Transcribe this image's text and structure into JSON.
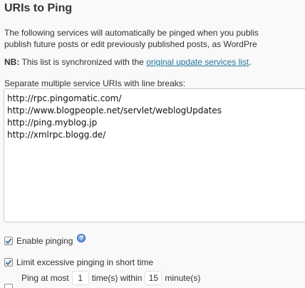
{
  "section_title": "URIs to Ping",
  "intro": {
    "line1": "The following services will automatically be pinged when you publis",
    "line2": "publish future posts or edit previously published posts, as WordPre"
  },
  "note": {
    "label": "NB:",
    "text": " This list is synchronized with the ",
    "link": "original update services list",
    "end": "."
  },
  "uris_label": "Separate multiple service URIs with line breaks:",
  "uris": [
    "http://rpc.pingomatic.com/",
    "http://www.blogpeople.net/servlet/weblogUpdates",
    "http://ping.myblog.jp",
    "http://xmlrpc.blogg.de/"
  ],
  "enable_pinging": {
    "label": "Enable pinging",
    "checked": true,
    "help_glyph": "?"
  },
  "limit_pinging": {
    "label": "Limit excessive pinging in short time",
    "checked": true
  },
  "ping_limit": {
    "prefix": "Ping at most",
    "count": "1",
    "middle": "time(s) within",
    "minutes": "15",
    "suffix": "minute(s)"
  },
  "colors": {
    "link": "#21759b",
    "check": "#3a6ea5"
  }
}
